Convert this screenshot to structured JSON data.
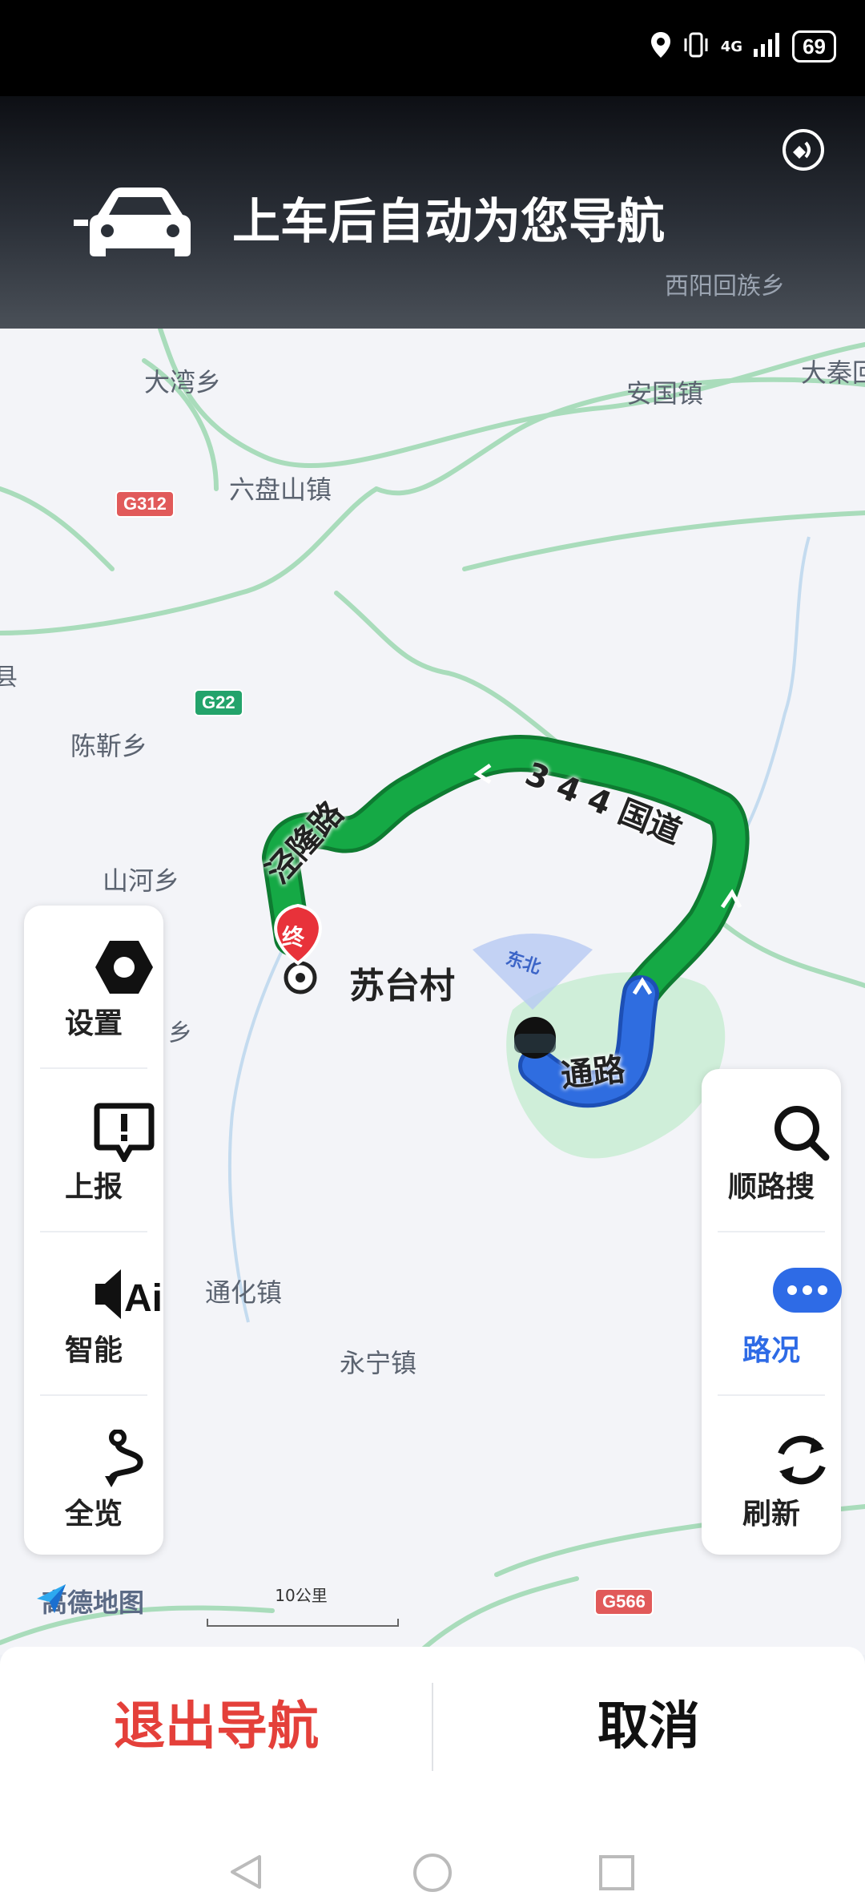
{
  "status_bar": {
    "network": "4G",
    "battery": "69"
  },
  "banner": {
    "title": "上车后自动为您导航",
    "hidden_place": "西阳回族乡"
  },
  "map": {
    "places": {
      "dawan": "大湾乡",
      "anguo": "安国镇",
      "daqin": "大秦回",
      "liupanshan": "六盘山镇",
      "chenjin": "陈靳乡",
      "shanhe": "山河乡",
      "partial_xiang": "乡",
      "partial_xian": "县",
      "tonghua": "通化镇",
      "yongning": "永宁镇"
    },
    "road_badges": {
      "g312": "G312",
      "g22": "G22",
      "g566": "G566"
    },
    "destination": {
      "marker": "终",
      "name": "苏台村"
    },
    "route_labels": {
      "jinglong": "泾隆路",
      "g344": "3 4 4 国道",
      "tong": "通路"
    },
    "heading": "东北",
    "logo": "高德地图",
    "scale": "10公里"
  },
  "left_panel": [
    {
      "label": "设置",
      "icon": "settings-icon"
    },
    {
      "label": "上报",
      "icon": "report-icon"
    },
    {
      "label": "智能",
      "icon": "ai-voice-icon"
    },
    {
      "label": "全览",
      "icon": "overview-icon"
    }
  ],
  "right_panel": [
    {
      "label": "顺路搜",
      "icon": "search-icon"
    },
    {
      "label": "路况",
      "icon": "traffic-icon"
    },
    {
      "label": "刷新",
      "icon": "refresh-icon"
    }
  ],
  "bottom": {
    "exit": "退出导航",
    "cancel": "取消"
  },
  "colors": {
    "route_green": "#15a945",
    "route_blue": "#2f6de0",
    "exit_red": "#e4403a",
    "traffic_blue": "#2e6be6"
  }
}
